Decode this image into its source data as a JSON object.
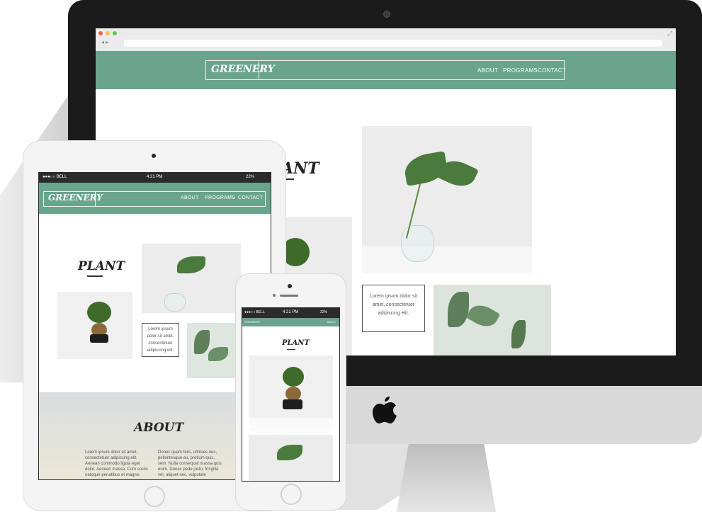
{
  "brand": "GREENERY",
  "nav": [
    "ABOUT",
    "PROGRAMS",
    "CONTACT"
  ],
  "plant_heading": "PLANT",
  "plant_heading_partial": "ANT",
  "lorem_box": [
    "Lorem ipsum dolor sit",
    "amet, consectetuer",
    "adipiscing elit."
  ],
  "lorem_box_ipad": [
    "Lorem ipsum",
    "dolor sit amet,",
    "consectetuer",
    "adipiscing elit."
  ],
  "about_heading": "ABOUT",
  "about_col1": [
    "Lorem ipsum dolor sit amet,",
    "consectetuer adipiscing elit.",
    "Aenean commodo ligula eget",
    "dolor. Aenean massa. Cum sociis",
    "natoque penatibus et magnis"
  ],
  "about_col2": [
    "Donec quam felis, ultricies nec,",
    "pellentesque eu, pretium quis,",
    "sem. Nulla consequat massa quis",
    "enim. Donec pede justo, fringilla",
    "vel, aliquet nec, vulputate"
  ],
  "ipad_status": {
    "carrier": "●●●○○ BELL",
    "time": "4:21 PM",
    "battery": "22%"
  },
  "iphone_status": {
    "carrier": "●●●○○ BELL",
    "time": "4:21 PM",
    "battery": "22%"
  },
  "iphone_brand": "GREENERY",
  "iphone_menu": "MENU",
  "colors": {
    "accent": "#6aa48c",
    "bezel": "#1b1b1b"
  }
}
